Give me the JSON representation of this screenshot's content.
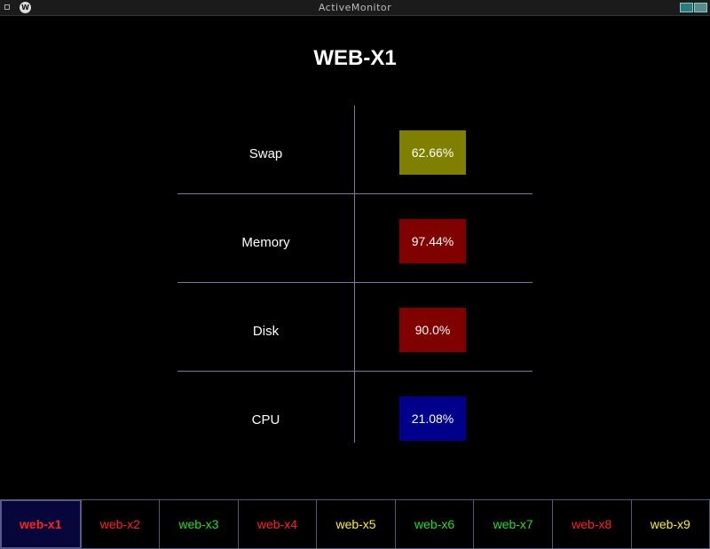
{
  "window": {
    "title": "ActiveMonitor",
    "logo_icon": "app-logo-icon"
  },
  "host": {
    "title": "WEB-X1"
  },
  "metrics": [
    {
      "label": "Swap",
      "value": "62.66%",
      "color": "#808000"
    },
    {
      "label": "Memory",
      "value": "97.44%",
      "color": "#800000"
    },
    {
      "label": "Disk",
      "value": "90.0%",
      "color": "#800000"
    },
    {
      "label": "CPU",
      "value": "21.08%",
      "color": "#00008b"
    }
  ],
  "tabs": [
    {
      "label": "web-x1",
      "color": "#ff2020",
      "active": true
    },
    {
      "label": "web-x2",
      "color": "#ff2020",
      "active": false
    },
    {
      "label": "web-x3",
      "color": "#22dd22",
      "active": false
    },
    {
      "label": "web-x4",
      "color": "#ff2020",
      "active": false
    },
    {
      "label": "web-x5",
      "color": "#ffee22",
      "active": false
    },
    {
      "label": "web-x6",
      "color": "#22dd22",
      "active": false
    },
    {
      "label": "web-x7",
      "color": "#22dd22",
      "active": false
    },
    {
      "label": "web-x8",
      "color": "#ff2020",
      "active": false
    },
    {
      "label": "web-x9",
      "color": "#ffee22",
      "active": false
    }
  ]
}
